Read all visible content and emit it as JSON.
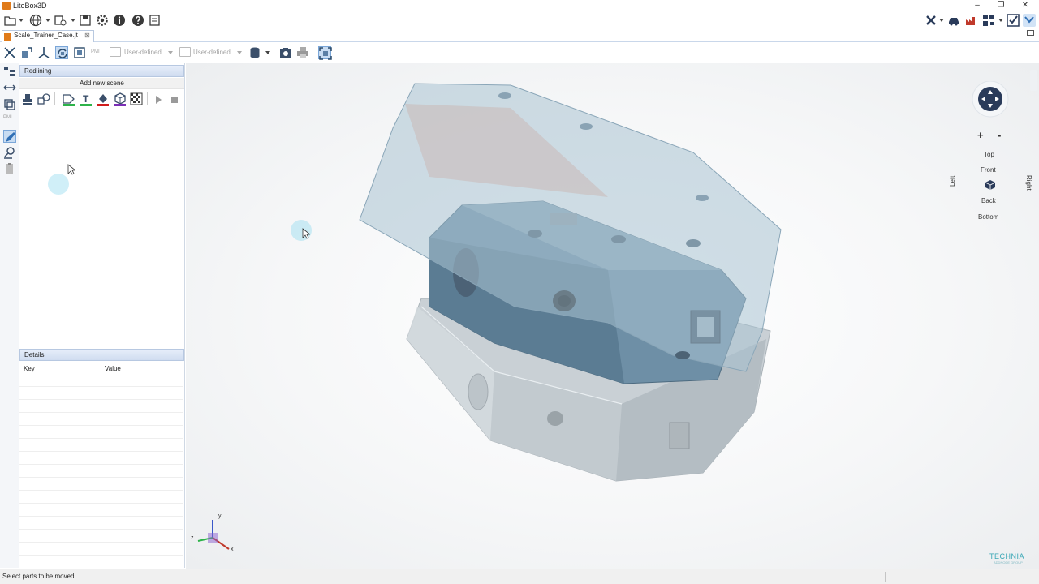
{
  "window": {
    "title": "LiteBox3D",
    "minimize": "–",
    "restore": "❐",
    "close": "✕"
  },
  "document_tab": {
    "label": "Scale_Trainer_Case.jt",
    "close": "⊠"
  },
  "toolbar": {
    "camera_view_1": "User-defined",
    "camera_view_2": "User-defined",
    "pmi_label": "PMI"
  },
  "redlining_panel": {
    "title": "Redlining",
    "add_scene_label": "Add new scene",
    "colors": {
      "line": "#2db34a",
      "text": "#2db34a",
      "fill": "#d01c1c",
      "shape": "#7a2fb5"
    }
  },
  "details_panel": {
    "title": "Details",
    "columns": [
      "Key",
      "Value"
    ],
    "rows": []
  },
  "nav_widget": {
    "zoom_in": "+",
    "zoom_out": "-",
    "top": "Top",
    "front": "Front",
    "back": "Back",
    "bottom": "Bottom",
    "left": "Left",
    "right": "Right"
  },
  "axis_triad": {
    "x": "x",
    "y": "y",
    "z": "z"
  },
  "brand": {
    "name": "TECHNIA",
    "tagline": "ADDNODE GROUP"
  },
  "status": {
    "message": "Select parts to be moved ..."
  },
  "colors": {
    "accent": "#2f6fb5",
    "part_blue": "#6f93aa",
    "part_grey": "#c5cdd3"
  }
}
